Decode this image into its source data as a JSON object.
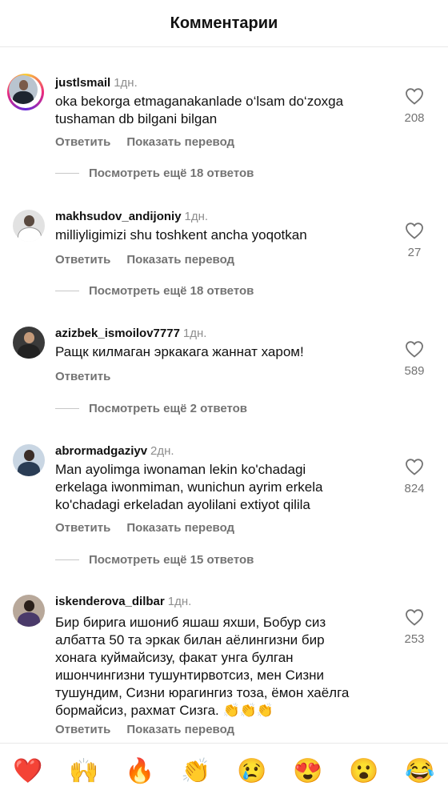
{
  "header": {
    "title": "Комментарии"
  },
  "actions": {
    "reply": "Ответить",
    "translate": "Показать перевод"
  },
  "comments": [
    {
      "user": "justlsmail",
      "time": "1дн.",
      "text": [
        "oka bekorga etmaganakanlade o‘lsam do‘zoxga",
        "tushaman db bilgani bilgan"
      ],
      "likes": "208",
      "replies": "Посмотреть ещё 18 ответов",
      "show_translate": true
    },
    {
      "user": "makhsudov_andijoniy",
      "time": "1дн.",
      "text": [
        "milliyligimizi shu toshkent ancha yoqotkan"
      ],
      "likes": "27",
      "replies": "Посмотреть ещё 18 ответов",
      "show_translate": true
    },
    {
      "user": "azizbek_ismoilov7777",
      "time": "1дн.",
      "text": [
        "Ращк килмаган эркакага жаннат харом!"
      ],
      "likes": "589",
      "replies": "Посмотреть ещё 2 ответов",
      "show_translate": false
    },
    {
      "user": "abrormadgaziyv",
      "time": "2дн.",
      "text": [
        "Man ayolimga iwonaman lekin ko'chadagi",
        "erkelaga iwonmiman, wunichun ayrim erkela",
        "ko'chadagi erkeladan ayolilani extiyot qilila"
      ],
      "likes": "824",
      "replies": "Посмотреть ещё 15 ответов",
      "show_translate": true
    },
    {
      "user": "iskenderova_dilbar",
      "time": "1дн.",
      "text": [
        "Бир бирига ишониб яшаш яхши, Бобур  сиз",
        "албатта 50 та эркак билан аёлингизни бир",
        "хонага куймайсизу, факат унга булган",
        "ишончингизни тушунтирвотсиз, мен Сизни",
        "тушундим, Сизни юрагингиз тоза, ёмон хаёлга",
        "бормайсиз, рахмат Сизга. 👏👏👏"
      ],
      "likes": "253",
      "replies": "",
      "show_translate": true
    }
  ],
  "reactions": [
    "❤️",
    "🙌",
    "🔥",
    "👏",
    "😢",
    "😍",
    "😮",
    "😂"
  ]
}
